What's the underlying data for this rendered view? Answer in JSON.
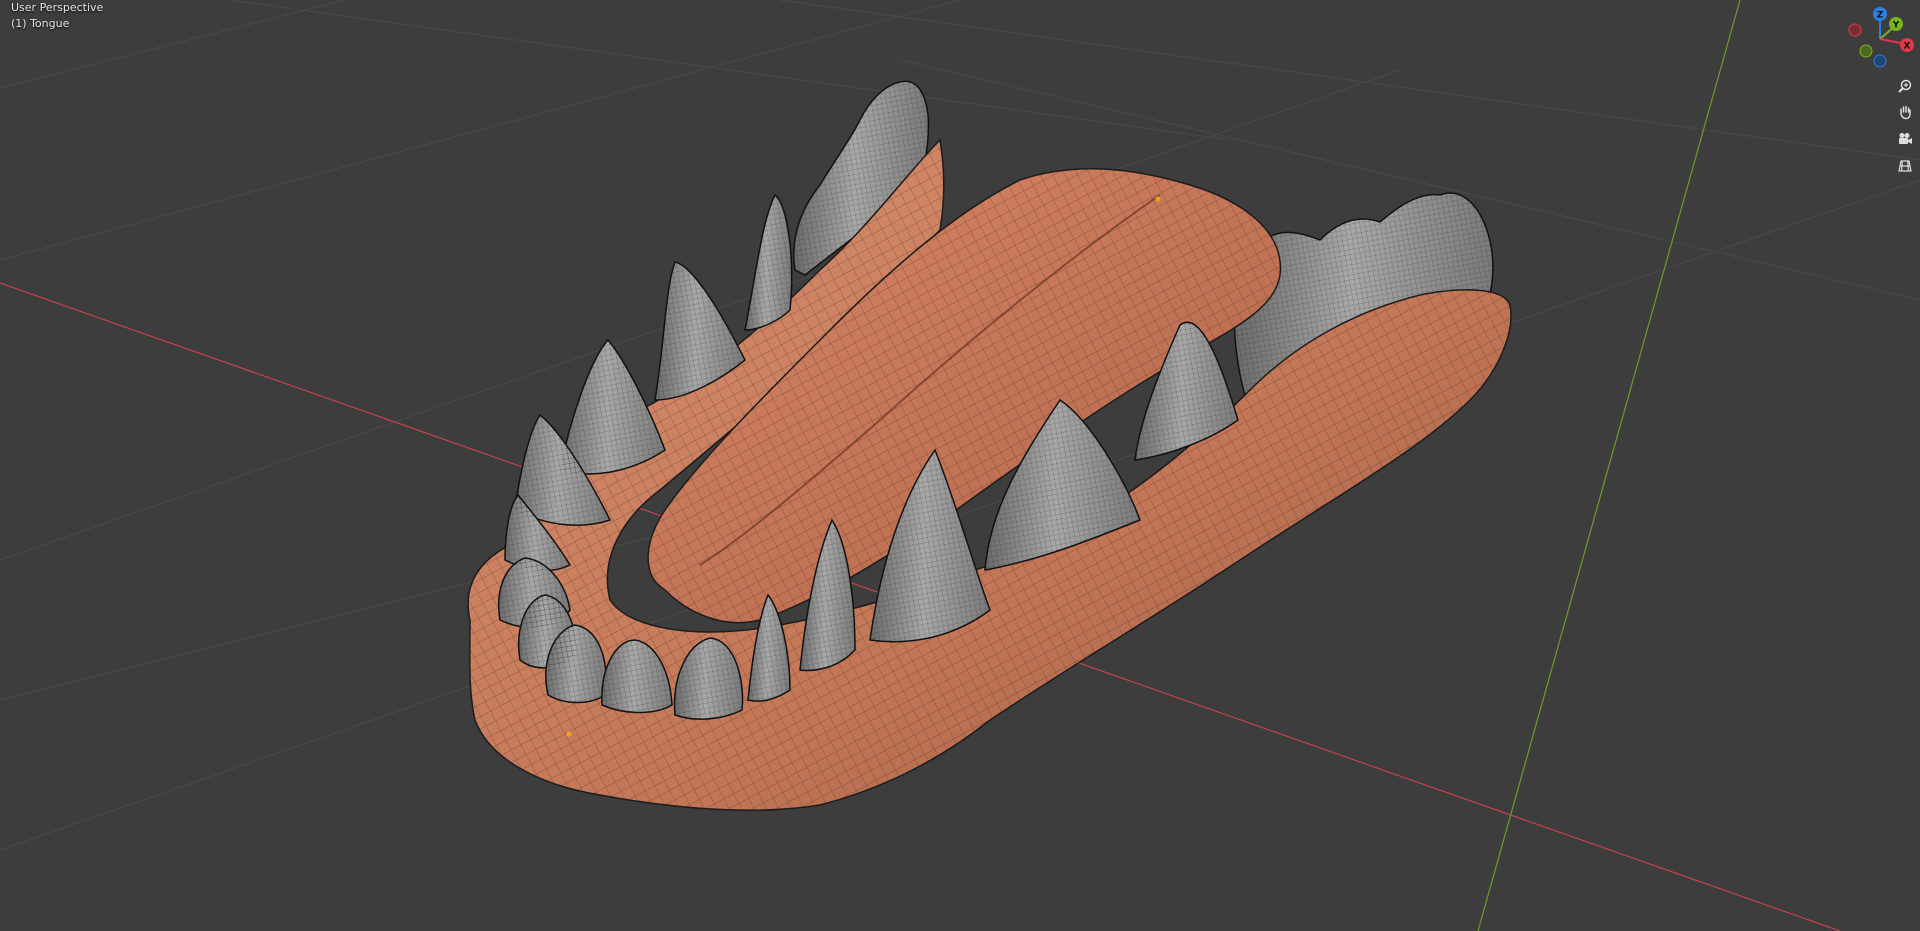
{
  "viewport": {
    "view_name": "User Perspective",
    "active_object": "(1) Tongue"
  },
  "gizmo": {
    "axes": [
      {
        "label": "Z",
        "color": "#2f7fe0"
      },
      {
        "label": "Y",
        "color": "#77b323"
      },
      {
        "label": "X",
        "color": "#e0394a"
      }
    ]
  },
  "nav_buttons": [
    {
      "name": "zoom-button",
      "icon": "magnifier-plus-icon"
    },
    {
      "name": "pan-button",
      "icon": "hand-icon"
    },
    {
      "name": "camera-view-button",
      "icon": "camera-icon"
    },
    {
      "name": "ortho-toggle-button",
      "icon": "grid-icon"
    }
  ],
  "colors": {
    "background": "#3d3d3d",
    "grid_line": "#4a4a4a",
    "x_axis": "#c2434e",
    "y_axis": "#6b9b2b",
    "flesh": "#c57a5a",
    "tooth": "#8e8e8e"
  }
}
